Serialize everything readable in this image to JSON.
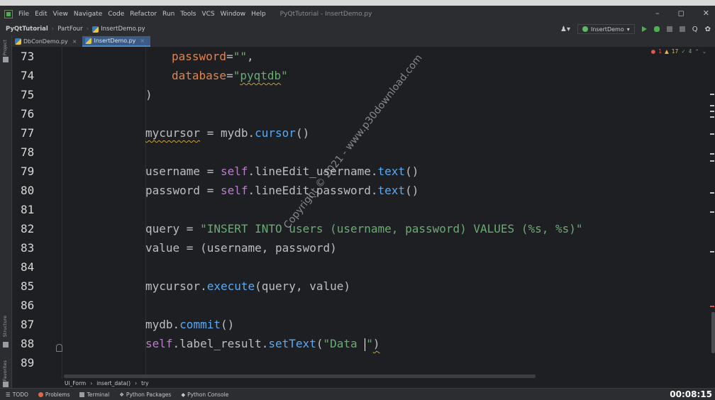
{
  "menu": {
    "items": [
      "File",
      "Edit",
      "View",
      "Navigate",
      "Code",
      "Refactor",
      "Run",
      "Tools",
      "VCS",
      "Window",
      "Help"
    ],
    "window_title": "PyQtTutorial - InsertDemo.py"
  },
  "window_controls": {
    "minimize": "–",
    "maximize": "◻",
    "close": "✕"
  },
  "nav": {
    "project": "PyQtTutorial",
    "folder": "PartFour",
    "file": "InsertDemo.py",
    "run_config": "InsertDemo",
    "user_icon": "user-icon",
    "search_icon": "Q",
    "settings_icon": "✿"
  },
  "left_strip": {
    "project_label": "Project",
    "structure_label": "Structure",
    "favorites_label": "Favorites"
  },
  "tabs": [
    {
      "label": "DbConDemo.py",
      "active": false
    },
    {
      "label": "InsertDemo.py",
      "active": true
    }
  ],
  "inspections": {
    "errors": "1",
    "warnings": "17",
    "weak": "4"
  },
  "code_lines": [
    {
      "num": "73"
    },
    {
      "num": "74"
    },
    {
      "num": "75"
    },
    {
      "num": "76"
    },
    {
      "num": "77"
    },
    {
      "num": "78"
    },
    {
      "num": "79"
    },
    {
      "num": "80"
    },
    {
      "num": "81"
    },
    {
      "num": "82"
    },
    {
      "num": "83"
    },
    {
      "num": "84"
    },
    {
      "num": "85"
    },
    {
      "num": "86"
    },
    {
      "num": "87"
    },
    {
      "num": "88"
    },
    {
      "num": "89"
    }
  ],
  "code": {
    "l73": {
      "param": "password",
      "eq": "=",
      "str": "\"\"",
      "tail": ","
    },
    "l74": {
      "param": "database",
      "eq": "=",
      "str_open": "\"",
      "str_body": "pyqtdb",
      "str_close": "\""
    },
    "l75": {
      "text": ")"
    },
    "l77": {
      "var": "mycursor",
      "eq": " = ",
      "obj": "mydb.",
      "call": "cursor",
      "args": "()"
    },
    "l79": {
      "var": "username",
      "eq": " = ",
      "self": "self",
      "attr": ".lineEdit_username.",
      "call": "text",
      "args": "()"
    },
    "l80": {
      "var": "password",
      "eq": " = ",
      "self": "self",
      "attr": ".lineEdit_password.",
      "call": "text",
      "args": "()"
    },
    "l82": {
      "var": "query",
      "eq": " = ",
      "str": "\"INSERT INTO users (username, password) VALUES (%s, %s)\""
    },
    "l83": {
      "var": "value",
      "eq": " = ",
      "tuple": "(username, password)"
    },
    "l85": {
      "obj": "mycursor.",
      "call": "execute",
      "args": "(query, value)"
    },
    "l87": {
      "obj": "mydb.",
      "call": "commit",
      "args": "()"
    },
    "l88": {
      "self": "self",
      "attr": ".label_result.",
      "call": "setText",
      "open": "(",
      "str_pre": "\"Data ",
      "str_post": "\"",
      "close": ")"
    }
  },
  "watermark": "Copyright © 2021 - www.p30download.com",
  "breadcrumb": [
    "Ui_Form",
    "insert_data()",
    "try"
  ],
  "breadcrumb_sep": "›",
  "status": [
    "TODO",
    "Problems",
    "Terminal",
    "Python Packages",
    "Python Console"
  ],
  "timer": "00:08:15",
  "colors": {
    "accent": "#3b5b85",
    "string": "#6aab73",
    "param": "#e0834f",
    "self": "#b77fc9",
    "call": "#57aaf7"
  }
}
